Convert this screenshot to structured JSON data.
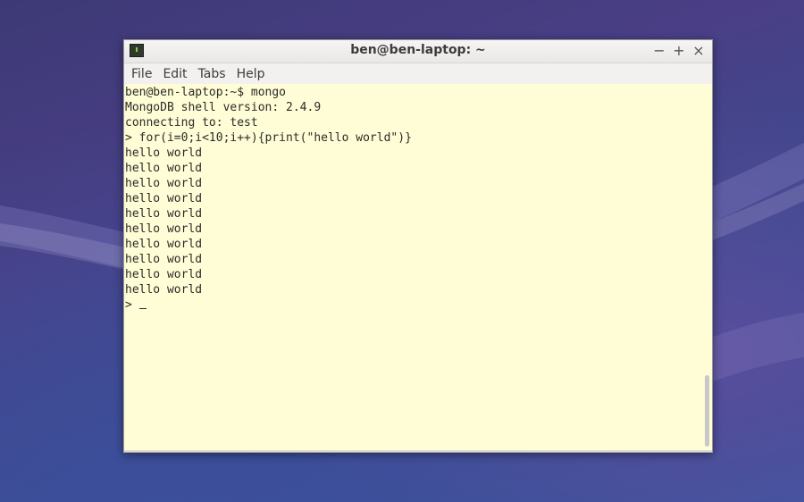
{
  "window": {
    "title": "ben@ben-laptop: ~",
    "controls": {
      "minimize": "−",
      "maximize": "+",
      "close": "×"
    },
    "icon": "terminal-icon"
  },
  "menu": {
    "items": [
      "File",
      "Edit",
      "Tabs",
      "Help"
    ]
  },
  "terminal": {
    "lines": [
      "ben@ben-laptop:~$ mongo",
      "MongoDB shell version: 2.4.9",
      "connecting to: test",
      "> for(i=0;i<10;i++){print(\"hello world\")}",
      "hello world",
      "hello world",
      "hello world",
      "hello world",
      "hello world",
      "hello world",
      "hello world",
      "hello world",
      "hello world",
      "hello world"
    ],
    "prompt": "> "
  },
  "colors": {
    "terminal_bg": "#fffdd5",
    "terminal_fg": "#2b2b2b",
    "window_chrome": "#f2f1f0"
  }
}
